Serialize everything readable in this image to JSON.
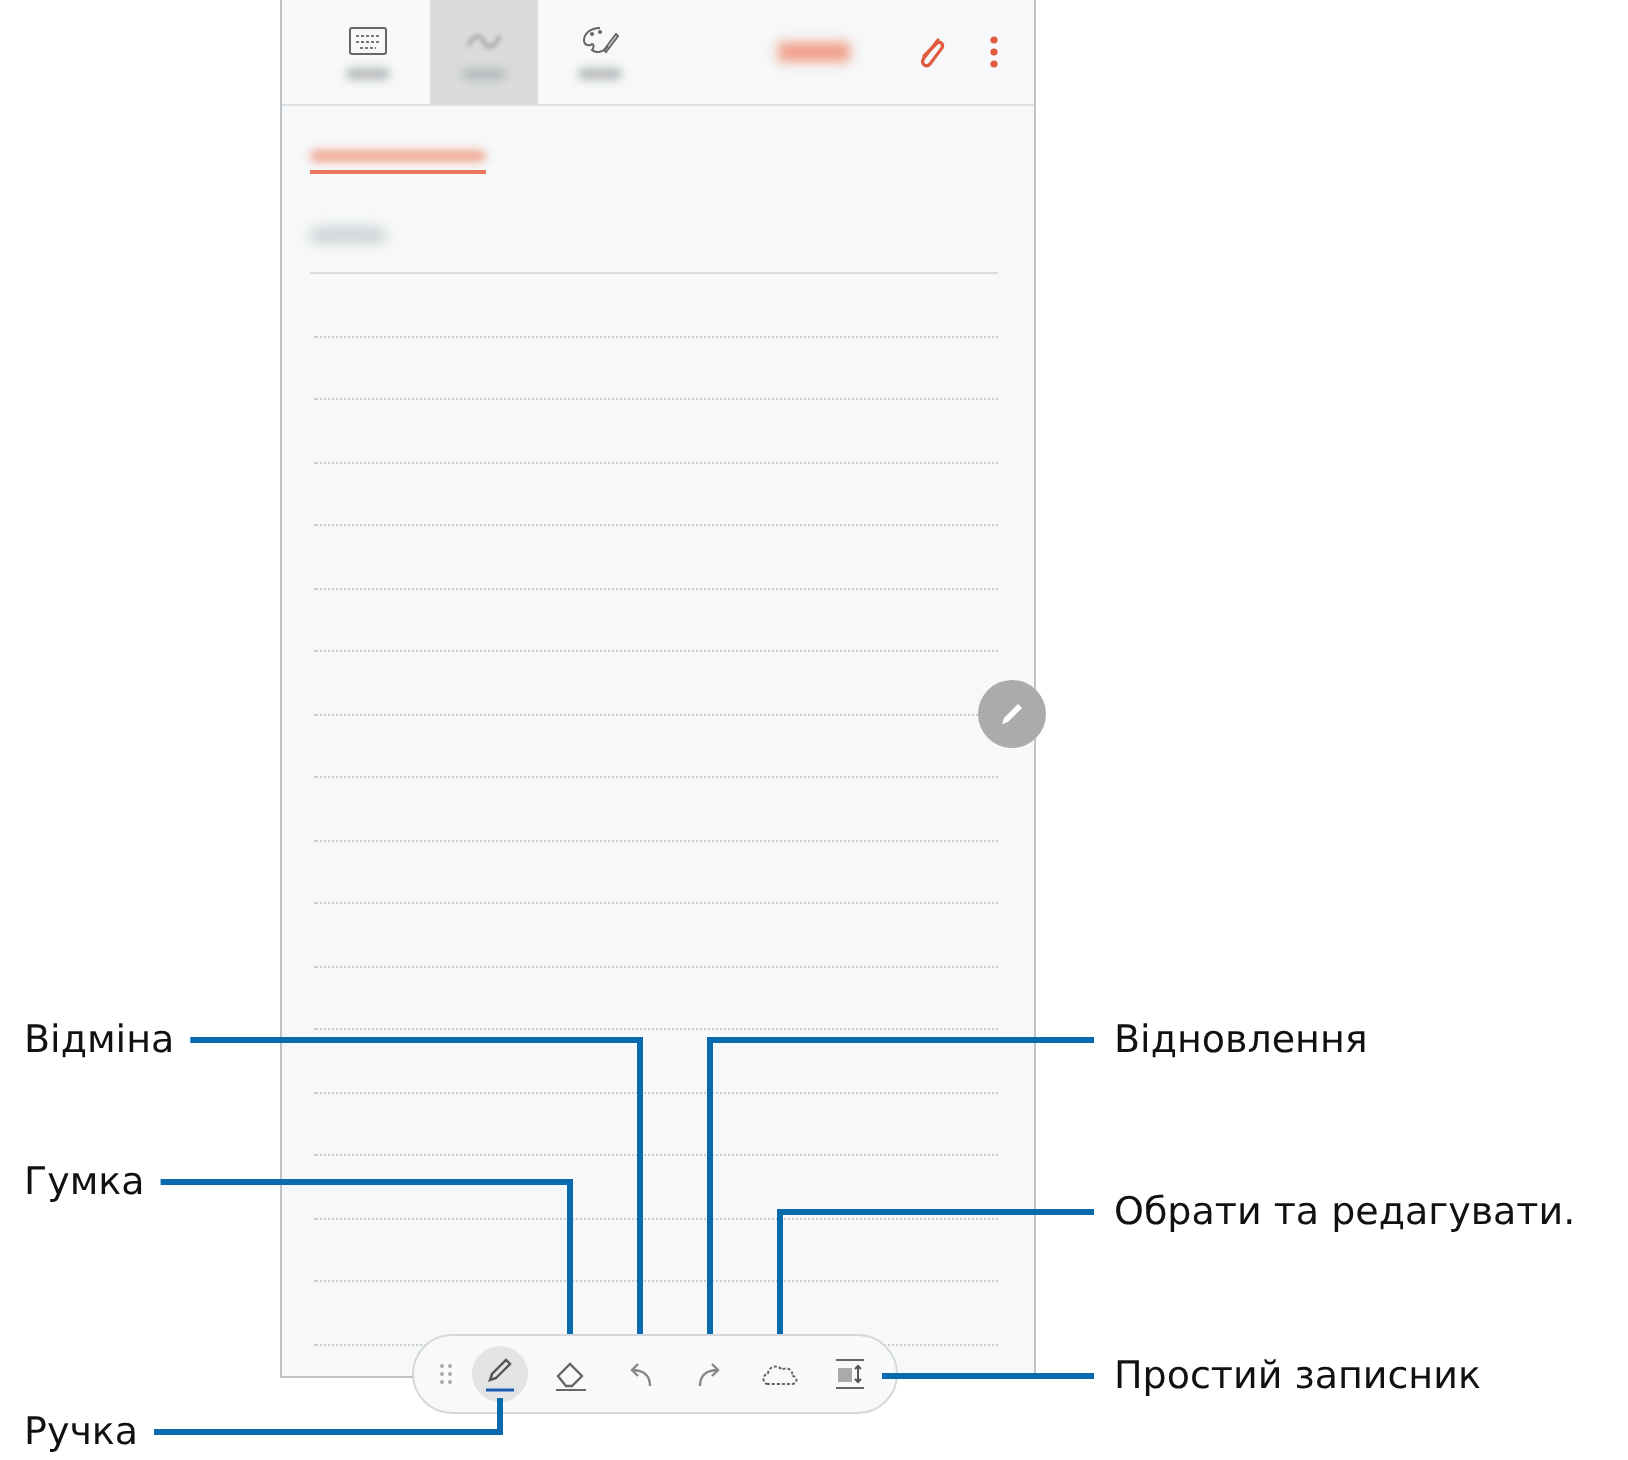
{
  "app_bar": {
    "tabs": [
      {
        "kind": "keyboard",
        "selected": false
      },
      {
        "kind": "handwriting",
        "selected": true
      },
      {
        "kind": "drawing",
        "selected": false
      }
    ]
  },
  "pen_toolbar": {
    "tools": [
      {
        "kind": "grip",
        "selected": false
      },
      {
        "kind": "pen",
        "selected": true
      },
      {
        "kind": "eraser",
        "selected": false
      },
      {
        "kind": "undo",
        "selected": false
      },
      {
        "kind": "redo",
        "selected": false
      },
      {
        "kind": "lasso",
        "selected": false
      },
      {
        "kind": "easy_pad",
        "selected": false
      }
    ]
  },
  "callouts": [
    {
      "kind": "undo",
      "text": "Відміна"
    },
    {
      "kind": "redo",
      "text": "Відновлення"
    },
    {
      "kind": "eraser",
      "text": "Гумка"
    },
    {
      "kind": "lasso",
      "text": "Обрати та редагувати."
    },
    {
      "kind": "easy_pad",
      "text": "Простий записник"
    },
    {
      "kind": "pen",
      "text": "Ручка"
    }
  ]
}
